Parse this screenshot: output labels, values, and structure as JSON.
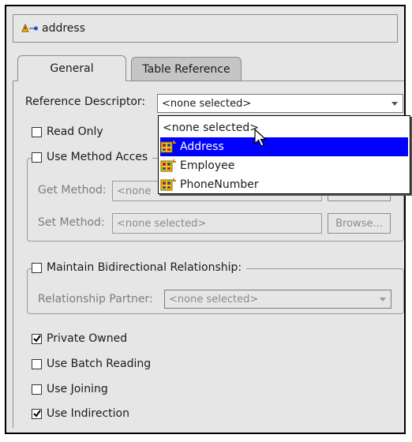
{
  "header": {
    "title": "address",
    "icon": "one-to-one-mapping-icon"
  },
  "tabs": [
    {
      "label": "General",
      "active": true
    },
    {
      "label": "Table Reference",
      "active": false
    }
  ],
  "general": {
    "reference_descriptor": {
      "label": "Reference Descriptor:",
      "value": "<none selected>"
    },
    "read_only": {
      "label": "Read Only",
      "checked": false
    },
    "use_method_accessing": {
      "label": "Use Method Acces",
      "checked": false,
      "get_method": {
        "label": "Get Method:",
        "value": "<none"
      },
      "set_method": {
        "label": "Set Method:",
        "value": "<none selected>",
        "button": "Browse..."
      }
    },
    "bidirectional": {
      "label": "Maintain Bidirectional Relationship:",
      "checked": false,
      "partner_label": "Relationship Partner:",
      "partner_value": "<none selected>"
    },
    "options": [
      {
        "label": "Private Owned",
        "checked": true
      },
      {
        "label": "Use Batch Reading",
        "checked": false
      },
      {
        "label": "Use Joining",
        "checked": false
      },
      {
        "label": "Use Indirection",
        "checked": true
      }
    ]
  },
  "dropdown": {
    "items": [
      {
        "label": "<none selected>",
        "icon": "",
        "selected": false
      },
      {
        "label": "Address",
        "icon": "descriptor-icon",
        "selected": true
      },
      {
        "label": "Employee",
        "icon": "descriptor-icon",
        "selected": false
      },
      {
        "label": "PhoneNumber",
        "icon": "descriptor-icon",
        "selected": false
      }
    ]
  },
  "colors": {
    "selection": "#0000ff",
    "panel": "#e6e6e6"
  }
}
